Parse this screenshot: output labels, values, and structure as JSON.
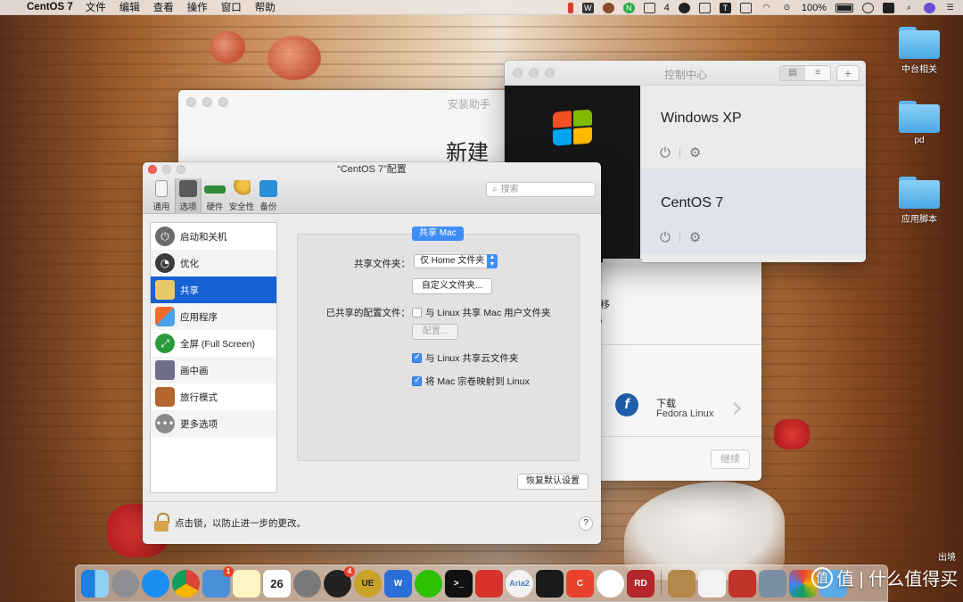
{
  "menubar": {
    "app_name": "CentOS 7",
    "items": [
      "文件",
      "编辑",
      "查看",
      "操作",
      "窗口",
      "帮助"
    ],
    "status": {
      "badge_count": "4",
      "battery_text": "100%"
    }
  },
  "desktop": {
    "icons": [
      "中台相关",
      "pd",
      "应用脚本"
    ]
  },
  "assistant": {
    "title": "安装助手",
    "heading": "新建",
    "migrate_line1": "迁移",
    "migrate_line2": "ws",
    "download_line1": "下载",
    "download_line2": "Fedora Linux",
    "continue_label": "继续"
  },
  "control_center": {
    "title": "控制中心",
    "vms": [
      {
        "name": "Windows XP"
      },
      {
        "name": "CentOS 7"
      }
    ]
  },
  "config": {
    "title": "“CentOS 7”配置",
    "tabs": [
      "通用",
      "选项",
      "硬件",
      "安全性",
      "备份"
    ],
    "search_placeholder": "搜索",
    "sidebar": [
      "启动和关机",
      "优化",
      "共享",
      "应用程序",
      "全屏 (Full Screen)",
      "画中画",
      "旅行模式",
      "更多选项"
    ],
    "panel": {
      "tag": "共享 Mac",
      "shared_folders_label": "共享文件夹：",
      "shared_folders_value": "仅 Home 文件夹",
      "custom_folders_button": "自定义文件夹...",
      "shared_profile_label": "已共享的配置文件：",
      "share_mac_user_folders": "与 Linux 共享 Mac 用户文件夹",
      "configure_button": "配置...",
      "share_cloud": "与 Linux 共享云文件夹",
      "map_volumes": "将 Mac 宗卷映射到 Linux",
      "checkbox_states": {
        "share_mac_user_folders": false,
        "share_cloud": true,
        "map_volumes": true
      }
    },
    "restore_button": "恢复默认设置",
    "lock_text": "点击锁，以防止进一步的更改。",
    "help": "?"
  },
  "dock": {
    "calendar_day": "26",
    "badge": "1",
    "qq_badge": "4",
    "aria_label": "Aria2"
  },
  "watermark": "值 | 什么值得买",
  "corner": "出境"
}
